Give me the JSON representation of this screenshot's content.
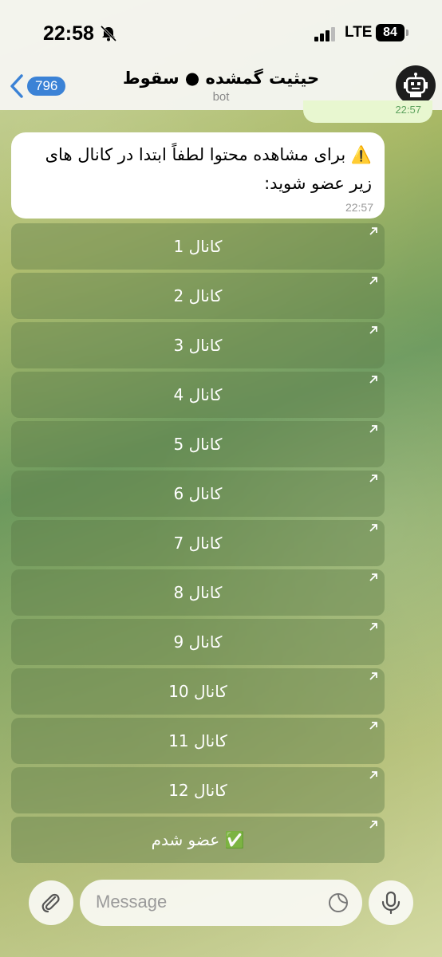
{
  "status": {
    "time": "22:58",
    "network": "LTE",
    "battery": "84"
  },
  "header": {
    "back_count": "796",
    "title": "حیثیت گمشده ● سقوط",
    "subtitle": "bot"
  },
  "message": {
    "text": "⚠️ برای مشاهده محتوا لطفاً ابتدا در کانال های زیر عضو شوید:",
    "time": "22:57"
  },
  "previous_message": {
    "time": "22:57"
  },
  "keyboard": {
    "buttons": [
      "کانال 1",
      "کانال 2",
      "کانال 3",
      "کانال 4",
      "کانال 5",
      "کانال 6",
      "کانال 7",
      "کانال 8",
      "کانال 9",
      "کانال 10",
      "کانال 11",
      "کانال 12",
      "✅ عضو شدم"
    ]
  },
  "input": {
    "placeholder": "Message"
  }
}
